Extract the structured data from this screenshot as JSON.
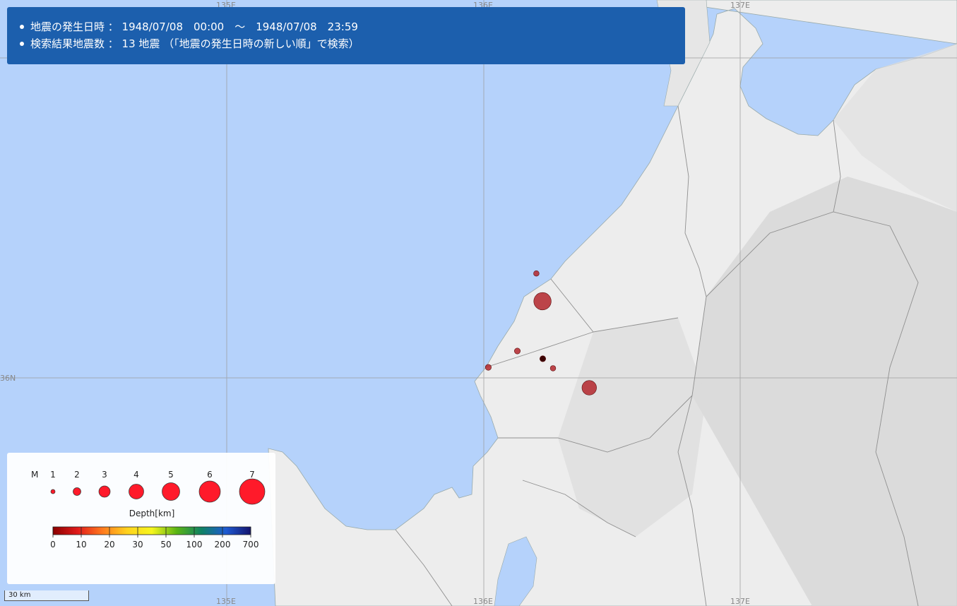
{
  "info": {
    "line1": "地震の発生日時 ： 1948/07/08　00:00　～　1948/07/08　23:59",
    "line2": "検索結果地震数 ： 13 地震 （「地震の発生日時の新しい順」で検索）"
  },
  "map": {
    "grid_labels": [
      "135E",
      "136E",
      "137E",
      "36N",
      "135E",
      "136E",
      "137E"
    ],
    "colors": {
      "sea": "#b5d2fb",
      "land": "#efefef",
      "grid": "#999999"
    }
  },
  "legend": {
    "m_label": "M",
    "magnitudes": [
      "1",
      "2",
      "3",
      "4",
      "5",
      "6",
      "7"
    ],
    "depth_title": "Depth[km]",
    "depth_ticks": [
      "0",
      "10",
      "20",
      "30",
      "50",
      "100",
      "200",
      "700"
    ],
    "depth_colors": [
      "#8b0000",
      "#e11b1b",
      "#ff7a1e",
      "#ffd21e",
      "#f6f61e",
      "#5ab414",
      "#0f8264",
      "#1e5ad2",
      "#14146e"
    ]
  },
  "earthquakes": [
    {
      "lon": 136.206,
      "lat": 36.327,
      "mag": 1.5,
      "depth": 10
    },
    {
      "lon": 136.23,
      "lat": 36.24,
      "mag": 4.5,
      "depth": 10
    },
    {
      "lon": 136.132,
      "lat": 36.084,
      "mag": 1.6,
      "depth": 10
    },
    {
      "lon": 136.231,
      "lat": 36.06,
      "mag": 1.6,
      "depth": 0
    },
    {
      "lon": 136.271,
      "lat": 36.03,
      "mag": 1.5,
      "depth": 10
    },
    {
      "lon": 136.019,
      "lat": 36.033,
      "mag": 1.6,
      "depth": 10
    },
    {
      "lon": 136.412,
      "lat": 35.969,
      "mag": 3.8,
      "depth": 10
    }
  ],
  "scale_label": "30 km"
}
